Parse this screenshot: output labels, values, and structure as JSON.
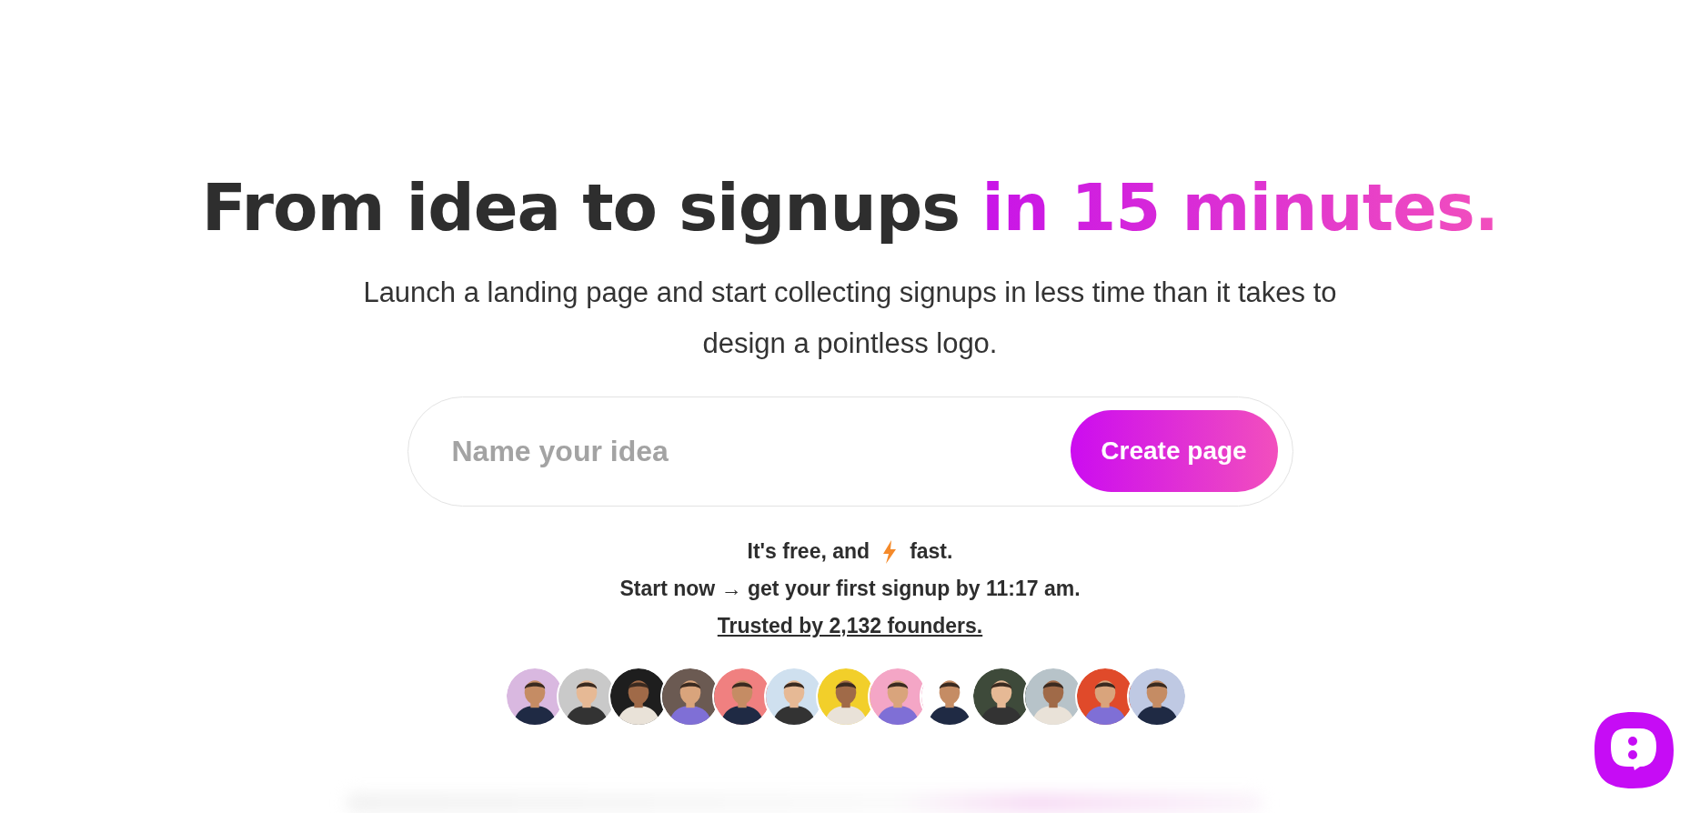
{
  "headline": {
    "text": "From idea to signups",
    "highlight": "in 15 minutes."
  },
  "subtitle": "Launch a landing page and start collecting signups in less time than it takes to design a pointless logo.",
  "form": {
    "placeholder": "Name your idea",
    "button": "Create page"
  },
  "notes": {
    "free_before": "It's free, and",
    "free_after": "fast.",
    "start": "Start now → get your first signup by 11:17 am.",
    "trusted": "Trusted by 2,132 founders."
  }
}
